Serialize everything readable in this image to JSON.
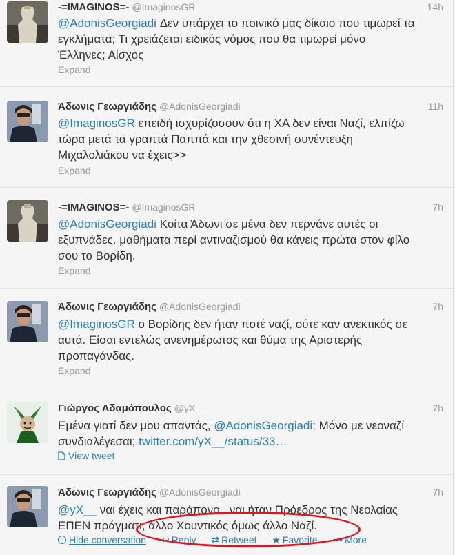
{
  "tweets": [
    {
      "name": "-=IMAGINOS=-",
      "handle": "@ImaginosGR",
      "time": "14h",
      "mention": "@AdonisGeorgiadi",
      "text_lines": [
        "Δεν υπάρχει το ποινικό μας δίκαιο που τιμωρεί τα",
        "εγκλήματα; Τι χρειάζεται ειδικός νόμος που θα τιμωρεί μόνο",
        "Έλληνες; Αίσχος"
      ],
      "footer": "Expand",
      "avatar": "statue-avatar"
    },
    {
      "name": "Άδωνις Γεωργιάδης",
      "handle": "@AdonisGeorgiadi",
      "time": "11h",
      "mention": "@ImaginosGR",
      "text_lines": [
        "επειδή ισχυρίζοσουν ότι η ΧΑ δεν είναι Ναζί, ελπίζω",
        "τώρα μετά τα γραπτά Παππά και την χθεσινή συνέντευξη",
        "Μιχαλολιάκου να έχεις>>"
      ],
      "footer": "Expand",
      "avatar": "man-portrait-avatar"
    },
    {
      "name": "-=IMAGINOS=-",
      "handle": "@ImaginosGR",
      "time": "7h",
      "mention": "@AdonisGeorgiadi",
      "text_lines": [
        "Κοίτα Άδωνι σε μένα δεν περνάνε αυτές οι",
        "εξυπνάδες. μαθήματα περί αντιναζισμού θα κάνεις πρώτα στον φίλο",
        "σου το Βορίδη."
      ],
      "footer": "Expand",
      "avatar": "statue-avatar"
    },
    {
      "name": "Άδωνις Γεωργιάδης",
      "handle": "@AdonisGeorgiadi",
      "time": "7h",
      "mention": "@ImaginosGR",
      "text_lines": [
        "ο Βορίδης δεν ήταν ποτέ ναζί, ούτε καν ανεκτικός σε",
        "αυτά. Είσαι εντελώς ανενημέρωτος και θύμα της Αριστερής",
        "προπαγάνδας."
      ],
      "footer": "Expand",
      "avatar": "man-portrait-avatar"
    },
    {
      "name": "Γιώργος Αδαμόπουλος",
      "handle": "@yX__",
      "time": "7h",
      "line1_before": "Εμένα γιατί δεν μου απαντάς,",
      "line1_mention": "@AdonisGeorgiadi",
      "line1_after": "; Μόνο με νεοναζί",
      "line2_before": "συνδιαλέγεσαι;",
      "line2_link": "twitter.com/yX__/status/33…",
      "footer": "View tweet",
      "avatar": "jester-avatar"
    },
    {
      "name": "Άδωνις Γεωργιάδης",
      "handle": "@AdonisGeorgiadi",
      "time": "7h",
      "mention": "@yX__",
      "text_lines": [
        "ναι έχεις και παράπονο...ναι ήταν Πρόεδρος της Νεολαίας",
        "ΕΠΕΝ πράγματι, άλλο Χουντικός όμως άλλο Ναζί."
      ],
      "actions": [
        "Hide conversation",
        "Reply",
        "Retweet",
        "Favorite",
        "More"
      ],
      "avatar": "man-portrait-avatar"
    }
  ],
  "colors": {
    "link": "#2a7cc0",
    "annotation": "#e2141b"
  }
}
